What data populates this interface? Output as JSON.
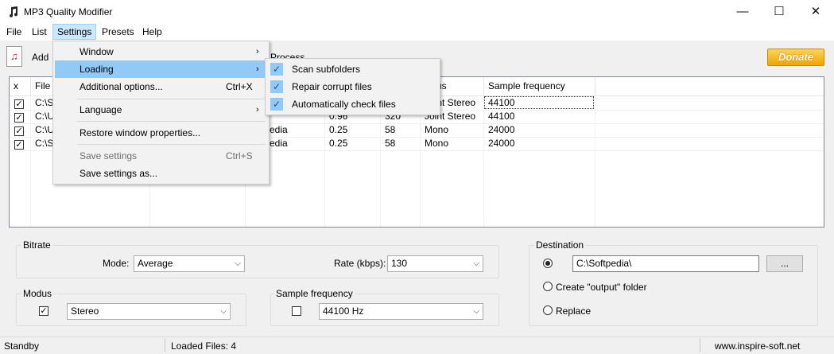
{
  "window": {
    "title": "MP3 Quality Modifier",
    "minimize": "—",
    "maximize": "☐",
    "close": "✕"
  },
  "menubar": {
    "items": [
      "File",
      "List",
      "Settings",
      "Presets",
      "Help"
    ]
  },
  "toolbar": {
    "add_label": "Add",
    "process_label": "Process",
    "donate_label": "Donate"
  },
  "list": {
    "columns": [
      "x",
      "File",
      "Modus",
      "Sample frequency"
    ],
    "rows": [
      {
        "checked": true,
        "file": "C:\\S",
        "c3": "",
        "c4": "",
        "modus": "Joint Stereo",
        "freq": "44100"
      },
      {
        "checked": true,
        "file": "C:\\U",
        "c3": "0.96",
        "c4": "320",
        "modus": "Joint Stereo",
        "freq": "44100"
      },
      {
        "checked": true,
        "file": "C:\\U",
        "c2": "edia",
        "c3": "0.25",
        "c4": "58",
        "modus": "Mono",
        "freq": "24000"
      },
      {
        "checked": true,
        "file": "C:\\S",
        "c2": "edia",
        "c3": "0.25",
        "c4": "58",
        "modus": "Mono",
        "freq": "24000"
      }
    ],
    "partial_header": "us"
  },
  "bitrate": {
    "legend": "Bitrate",
    "mode_label": "Mode:",
    "mode_value": "Average",
    "rate_label": "Rate (kbps):",
    "rate_value": "130"
  },
  "modus": {
    "legend": "Modus",
    "checked": true,
    "value": "Stereo"
  },
  "sample": {
    "legend": "Sample frequency",
    "checked": false,
    "value": "44100 Hz"
  },
  "destination": {
    "legend": "Destination",
    "path": "C:\\Softpedia\\",
    "browse_label": "...",
    "output_label": "Create \"output\" folder",
    "replace_label": "Replace"
  },
  "status": {
    "state": "Standby",
    "loaded": "Loaded Files: 4",
    "url": "www.inspire-soft.net"
  },
  "settings_menu": {
    "items": [
      {
        "label": "Window",
        "shortcut": "",
        "submenu": true
      },
      {
        "label": "Loading",
        "shortcut": "",
        "submenu": true
      },
      {
        "label": "Additional options...",
        "shortcut": "Ctrl+X",
        "submenu": false
      },
      {
        "label": "Language",
        "shortcut": "",
        "submenu": true
      },
      {
        "label": "Restore window properties...",
        "shortcut": "",
        "submenu": false
      },
      {
        "label": "Save settings",
        "shortcut": "Ctrl+S",
        "submenu": false,
        "disabled": true
      },
      {
        "label": "Save settings as...",
        "shortcut": "",
        "submenu": false
      }
    ]
  },
  "loading_menu": {
    "items": [
      {
        "label": "Scan subfolders",
        "checked": true
      },
      {
        "label": "Repair corrupt files",
        "checked": true
      },
      {
        "label": "Automatically check files",
        "checked": true
      }
    ]
  },
  "icons": {
    "check": "✓",
    "submenu_arrow": "›",
    "combo_arrow": "⌵",
    "note": "♫"
  }
}
